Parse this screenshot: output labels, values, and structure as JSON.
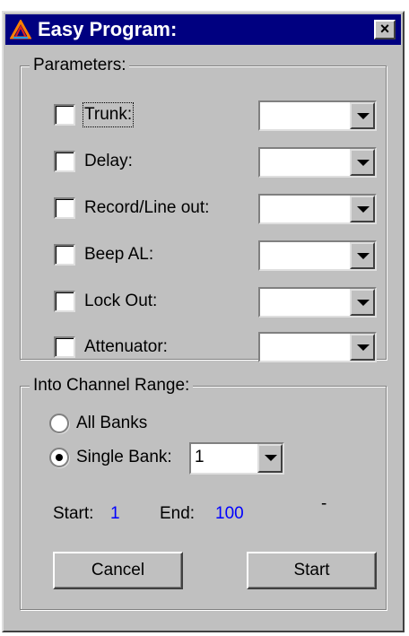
{
  "window": {
    "title": "Easy Program:",
    "close_glyph": "×"
  },
  "colors": {
    "titlebar": "#000080",
    "face": "#c0c0c0",
    "value_text": "#0000ff"
  },
  "parameters": {
    "legend": "Parameters:",
    "items": [
      {
        "label": "Trunk:",
        "checked": false,
        "value": ""
      },
      {
        "label": "Delay:",
        "checked": false,
        "value": ""
      },
      {
        "label": "Record/Line out:",
        "checked": false,
        "value": ""
      },
      {
        "label": "Beep AL:",
        "checked": false,
        "value": ""
      },
      {
        "label": "Lock Out:",
        "checked": false,
        "value": ""
      },
      {
        "label": "Attenuator:",
        "checked": false,
        "value": ""
      }
    ]
  },
  "range": {
    "legend": "Into Channel Range:",
    "all_banks_label": "All Banks",
    "single_bank_label": "Single Bank:",
    "selected": "single_bank",
    "bank_value": "1",
    "start_label": "Start:",
    "start_value": "1",
    "end_label": "End:",
    "end_value": "100",
    "dash": "-"
  },
  "buttons": {
    "cancel": "Cancel",
    "start": "Start"
  },
  "icons": {
    "app": "app-logo-icon",
    "close": "close-icon",
    "dropdown": "chevron-down-icon"
  }
}
